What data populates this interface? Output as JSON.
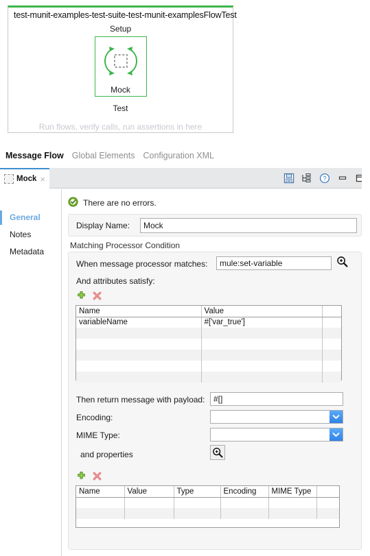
{
  "flow": {
    "title": "test-munit-examples-test-suite-test-munit-examplesFlowTest",
    "setup_label": "Setup",
    "test_label": "Test",
    "hint": "Run flows, verify calls, run assertions in here",
    "node": {
      "name": "Mock",
      "icon": "mock-icon"
    },
    "accent_color": "#3cb54a"
  },
  "view_tabs": [
    {
      "label": "Message Flow",
      "active": true
    },
    {
      "label": "Global Elements",
      "active": false
    },
    {
      "label": "Configuration XML",
      "active": false
    }
  ],
  "editor": {
    "tab": {
      "label": "Mock",
      "icon": "mock-tab-icon",
      "close": "×"
    },
    "toolbar": [
      {
        "name": "save-icon",
        "title": "Save"
      },
      {
        "name": "sort-tree-icon",
        "title": "Sort"
      },
      {
        "name": "help-icon",
        "title": "Help"
      },
      {
        "name": "minimize-icon",
        "title": "Minimize"
      },
      {
        "name": "maximize-icon",
        "title": "Maximize"
      }
    ],
    "nav": [
      {
        "label": "General",
        "active": true
      },
      {
        "label": "Notes",
        "active": false
      },
      {
        "label": "Metadata",
        "active": false
      }
    ],
    "status": {
      "text": "There are no errors.",
      "icon": "ok-check-icon",
      "color": "#6aac22"
    },
    "display_name": {
      "label": "Display Name:",
      "value": "Mock",
      "placeholder": ""
    },
    "matching": {
      "legend": "Matching Processor Condition",
      "processor_label": "When message processor matches:",
      "processor_value": "mule:set-variable",
      "processor_placeholder": "",
      "search_icon": "magnifier-plus-icon",
      "attributes_label": "And attributes satisfy:",
      "add_label": "+",
      "delete_label": "✖",
      "attributes_grid": {
        "columns": [
          "Name",
          "Value",
          ""
        ],
        "rows": [
          [
            "variableName",
            "#['var_true']",
            ""
          ],
          [
            "",
            "",
            ""
          ],
          [
            "",
            "",
            ""
          ],
          [
            "",
            "",
            ""
          ],
          [
            "",
            "",
            ""
          ],
          [
            "",
            "",
            ""
          ]
        ]
      },
      "payload_label": "Then return message with payload:",
      "payload_value": "#[]",
      "encoding_label": "Encoding:",
      "encoding_value": "",
      "mime_label": "MIME Type:",
      "mime_value": "",
      "properties_label": "and properties",
      "properties_search_icon": "magnifier-plus-icon",
      "properties_grid": {
        "columns": [
          "Name",
          "Value",
          "Type",
          "Encoding",
          "MIME Type",
          ""
        ],
        "rows": [
          [
            "",
            "",
            "",
            "",
            "",
            ""
          ],
          [
            "",
            "",
            "",
            "",
            "",
            ""
          ]
        ]
      }
    }
  }
}
